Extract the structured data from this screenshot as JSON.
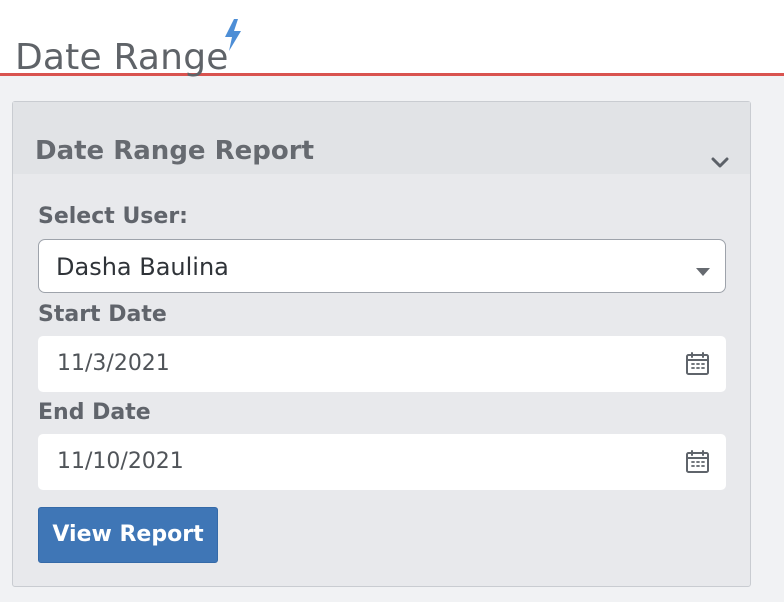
{
  "page": {
    "title": "Date Range",
    "title_icon": "lightning-bolt-icon"
  },
  "panel": {
    "title": "Date Range Report",
    "collapse_icon": "chevron-down-icon"
  },
  "form": {
    "user_label": "Select User:",
    "selected_user": "Dasha Baulina",
    "start_label": "Start Date",
    "start_date": "11/3/2021",
    "end_label": "End Date",
    "end_date": "11/10/2021",
    "submit_label": "View Report"
  },
  "colors": {
    "accent_rule": "#d9534f",
    "bolt": "#4d8ed6",
    "primary_button": "#3f76b6"
  }
}
